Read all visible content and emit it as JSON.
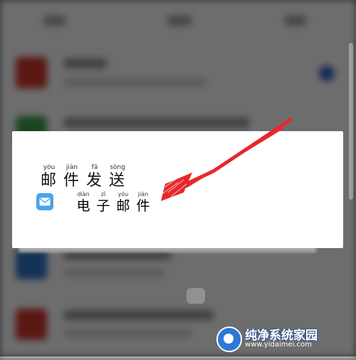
{
  "share_sheet": {
    "title": {
      "chars": [
        "邮",
        "件",
        "发",
        "送"
      ],
      "pinyin": [
        "yóu",
        "jiàn",
        "fā",
        "sòng"
      ]
    },
    "item": {
      "icon": "mail-icon",
      "chars": [
        "电",
        "子",
        "邮",
        "件"
      ],
      "pinyin": [
        "diàn",
        "zǐ",
        "yóu",
        "jiàn"
      ]
    }
  },
  "watermark": {
    "title": "纯净系统家园",
    "url": "www.yidaimei.com"
  },
  "colors": {
    "annotation_arrow": "#e8282b",
    "mail_icon": "#4aa3ea"
  }
}
